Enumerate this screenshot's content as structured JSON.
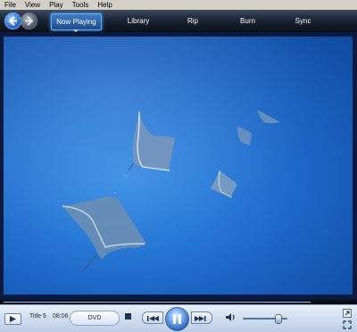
{
  "menu": [
    "File",
    "View",
    "Play",
    "Tools",
    "Help"
  ],
  "tabs": {
    "now_playing": "Now Playing",
    "library": "Library",
    "rip": "Rip",
    "burn": "Burn",
    "sync": "Sync"
  },
  "transport": {
    "title": "Title 5",
    "time": "08:06",
    "dvd_label": "DVD",
    "playback_progress": 0.88,
    "volume_level": 0.8
  },
  "icons": {
    "back": "back-arrow-icon",
    "forward": "forward-arrow-icon",
    "play": "play-icon",
    "stop": "stop-icon",
    "previous": "previous-icon",
    "pause": "pause-icon",
    "next": "next-icon",
    "volume": "speaker-icon",
    "switch_mode": "switch-to-compact-icon",
    "fullscreen": "fullscreen-icon"
  },
  "colors": {
    "accent": "#2a63b8",
    "video_water": "#2a7bd8"
  }
}
